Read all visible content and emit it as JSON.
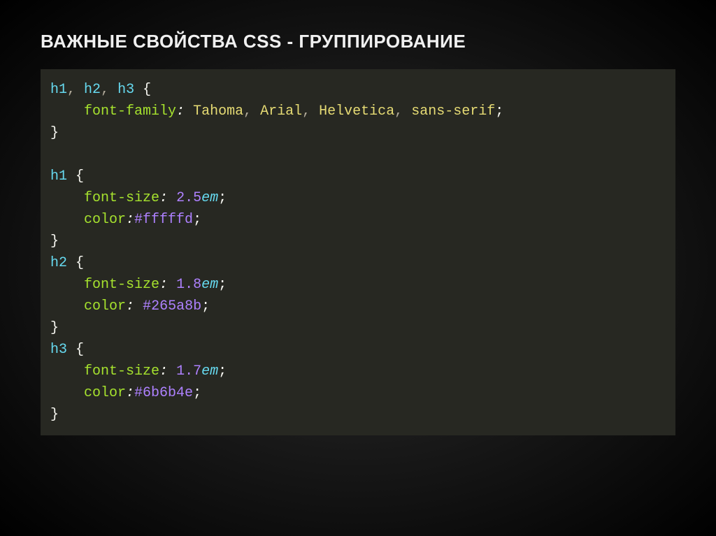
{
  "title": "ВАЖНЫЕ СВОЙСТВА CSS - ГРУППИРОВАНИЕ",
  "code": {
    "rule1": {
      "sel1": "h1",
      "comma1": ",",
      "sp1": " ",
      "sel2": "h2",
      "comma2": ",",
      "sp2": " ",
      "sel3": "h3",
      "sp3": " ",
      "open": "{",
      "indent": "    ",
      "prop": "font-family",
      "colon": ":",
      "spv": " ",
      "v1": "Tahoma",
      "c1": ",",
      "s1": " ",
      "v2": "Arial",
      "c2": ",",
      "s2": " ",
      "v3": "Helvetica",
      "c3": ",",
      "s3": " ",
      "v4": "sans-serif",
      "semi": ";",
      "close": "}"
    },
    "rule2": {
      "sel": "h1",
      "sp": " ",
      "open": "{",
      "indent": "    ",
      "p1": "font-size",
      "colon1": ":",
      "spv1": " ",
      "num1": "2.5",
      "unit1": "em",
      "semi1": ";",
      "p2": "color",
      "colon2": ":",
      "hash2": "#fffffd",
      "semi2": ";",
      "close": "}"
    },
    "rule3": {
      "sel": "h2",
      "sp": " ",
      "open": "{",
      "indent": "    ",
      "p1": "font-size",
      "colon1": ":",
      "spv1": " ",
      "num1": "1.8",
      "unit1": "em",
      "semi1": ";",
      "p2": "color",
      "colon2": ":",
      "spv2": " ",
      "hash2": "#265a8b",
      "semi2": ";",
      "close": "}"
    },
    "rule4": {
      "sel": "h3",
      "sp": " ",
      "open": "{",
      "indent": "    ",
      "p1": "font-size",
      "colon1": ":",
      "spv1": " ",
      "num1": "1.7",
      "unit1": "em",
      "semi1": ";",
      "p2": "color",
      "colon2": ":",
      "hash2": "#6b6b4e",
      "semi2": ";",
      "close": "}"
    }
  }
}
